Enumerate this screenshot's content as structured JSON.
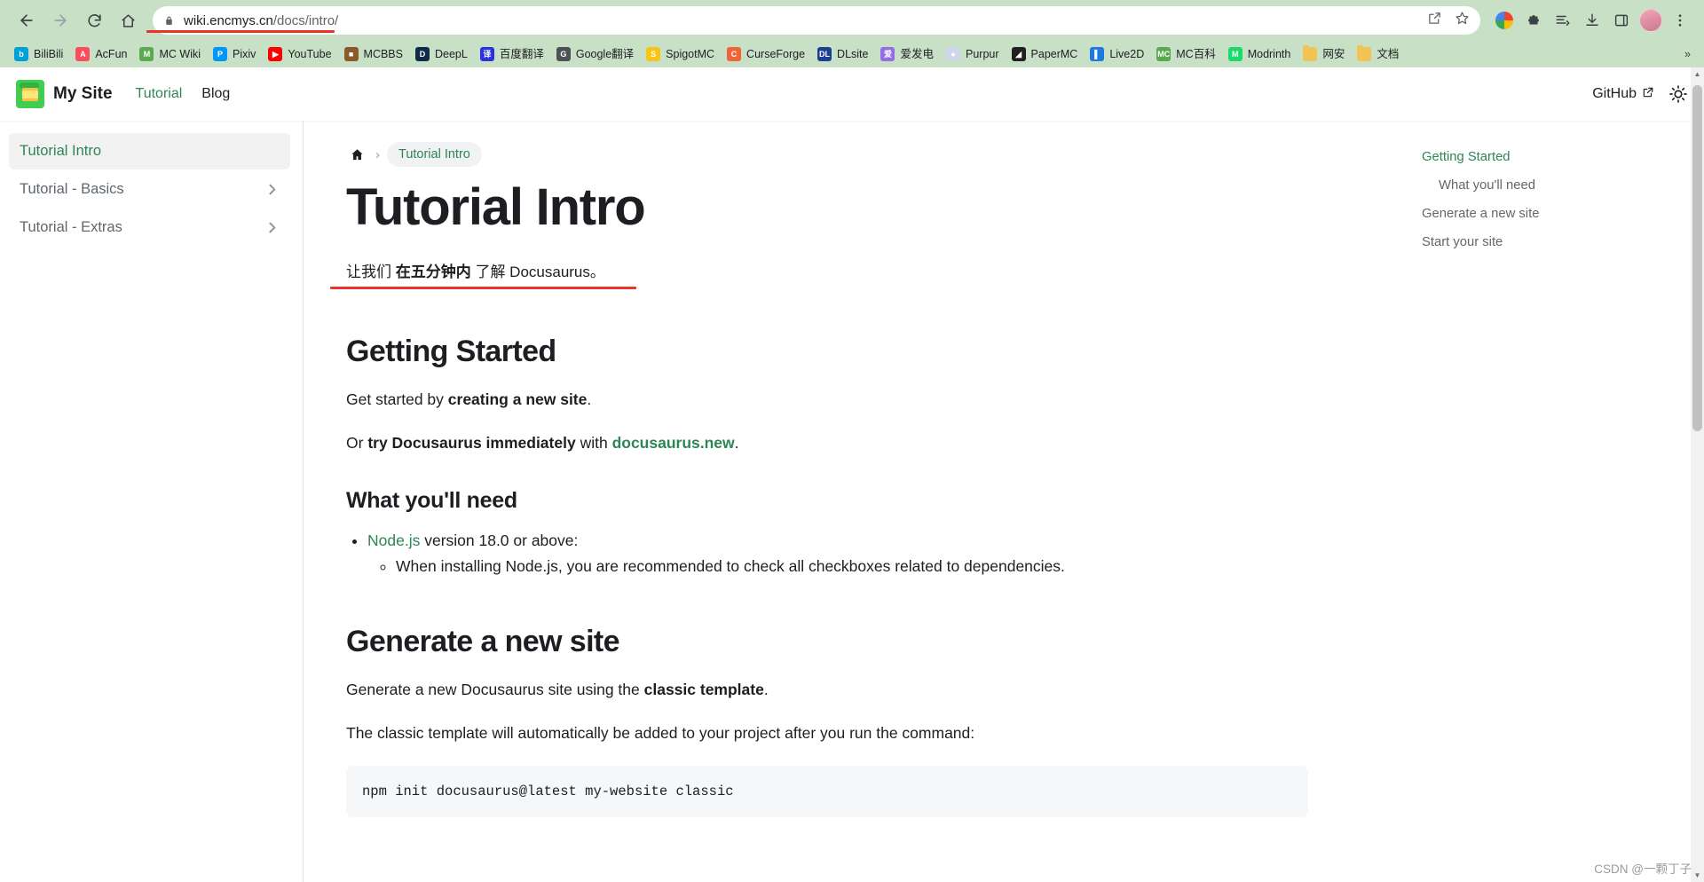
{
  "browser": {
    "url_host": "wiki.encmys.cn",
    "url_path": "/docs/intro/",
    "back_icon": "back-arrow-icon",
    "forward_icon": "forward-arrow-icon",
    "reload_icon": "reload-icon",
    "home_icon": "home-icon",
    "lock_icon": "lock-icon",
    "share_icon": "share-icon",
    "star_icon": "star-icon",
    "menu_icon": "kebab-menu-icon",
    "accent_red": "#e8342a",
    "chrome_bg": "#c8e0c5"
  },
  "bookmarks": {
    "items": [
      {
        "label": "BiliBili",
        "initial": "b",
        "color": "#00a1d6"
      },
      {
        "label": "AcFun",
        "initial": "A",
        "color": "#fd4c5b"
      },
      {
        "label": "MC Wiki",
        "initial": "M",
        "color": "#5aa84f"
      },
      {
        "label": "Pixiv",
        "initial": "P",
        "color": "#0096fa"
      },
      {
        "label": "YouTube",
        "initial": "▶",
        "color": "#ff0000"
      },
      {
        "label": "MCBBS",
        "initial": "■",
        "color": "#8b5a2b"
      },
      {
        "label": "DeepL",
        "initial": "D",
        "color": "#0f2b46"
      },
      {
        "label": "百度翻译",
        "initial": "译",
        "color": "#2932e1"
      },
      {
        "label": "Google翻译",
        "initial": "G",
        "color": "#4e5257"
      },
      {
        "label": "SpigotMC",
        "initial": "S",
        "color": "#f5c518"
      },
      {
        "label": "CurseForge",
        "initial": "C",
        "color": "#f16436"
      },
      {
        "label": "DLsite",
        "initial": "DL",
        "color": "#1b3f92"
      },
      {
        "label": "爱发电",
        "initial": "爱",
        "color": "#946ce6"
      },
      {
        "label": "Purpur",
        "initial": "●",
        "color": "#cfd8ea"
      },
      {
        "label": "PaperMC",
        "initial": "◢",
        "color": "#1f1f1f"
      },
      {
        "label": "Live2D",
        "initial": "▌",
        "color": "#1f7ae0"
      },
      {
        "label": "MC百科",
        "initial": "MC",
        "color": "#5aa84f"
      },
      {
        "label": "Modrinth",
        "initial": "M",
        "color": "#1bd96a"
      },
      {
        "label": "网安",
        "initial": "",
        "color": "#f1c453",
        "is_folder": true
      },
      {
        "label": "文档",
        "initial": "",
        "color": "#f1c453",
        "is_folder": true
      }
    ],
    "overflow_label": "»"
  },
  "site": {
    "brand": "My Site",
    "logo_icon": "docusaurus-logo-icon",
    "nav": [
      {
        "label": "Tutorial",
        "active": true
      },
      {
        "label": "Blog",
        "active": false
      }
    ],
    "github_label": "GitHub",
    "github_external_icon": "external-link-icon",
    "theme_toggle_icon": "sun-icon",
    "accent_green": "#2e8555"
  },
  "sidebar": {
    "items": [
      {
        "label": "Tutorial Intro",
        "active": true,
        "expandable": false
      },
      {
        "label": "Tutorial - Basics",
        "active": false,
        "expandable": true
      },
      {
        "label": "Tutorial - Extras",
        "active": false,
        "expandable": true
      }
    ],
    "caret_icon": "chevron-right-icon"
  },
  "breadcrumb": {
    "home_icon": "home-icon",
    "separator": "›",
    "current": "Tutorial Intro"
  },
  "doc": {
    "title": "Tutorial Intro",
    "lead_prefix": "让我们 ",
    "lead_bold": "在五分钟内",
    "lead_suffix": " 了解 Docusaurus。",
    "h2_getting_started": "Getting Started",
    "p1_pre": "Get started by ",
    "p1_bold": "creating a new site",
    "p1_post": ".",
    "p2_pre": "Or ",
    "p2_bold": "try Docusaurus immediately",
    "p2_mid": " with ",
    "p2_link": "docusaurus.new",
    "p2_post": ".",
    "h3_what_need": "What you'll need",
    "li1_link": "Node.js",
    "li1_rest": " version 18.0 or above:",
    "li1_sub": "When installing Node.js, you are recommended to check all checkboxes related to dependencies.",
    "h2_generate": "Generate a new site",
    "p3_pre": "Generate a new Docusaurus site using the ",
    "p3_bold": "classic template",
    "p3_post": ".",
    "p4": "The classic template will automatically be added to your project after you run the command:",
    "code": "npm init docusaurus@latest my-website classic"
  },
  "toc": {
    "items": [
      {
        "label": "Getting Started",
        "active": true,
        "sub": false
      },
      {
        "label": "What you'll need",
        "active": false,
        "sub": true
      },
      {
        "label": "Generate a new site",
        "active": false,
        "sub": false
      },
      {
        "label": "Start your site",
        "active": false,
        "sub": false
      }
    ]
  },
  "watermark": "CSDN @一颗丁子"
}
